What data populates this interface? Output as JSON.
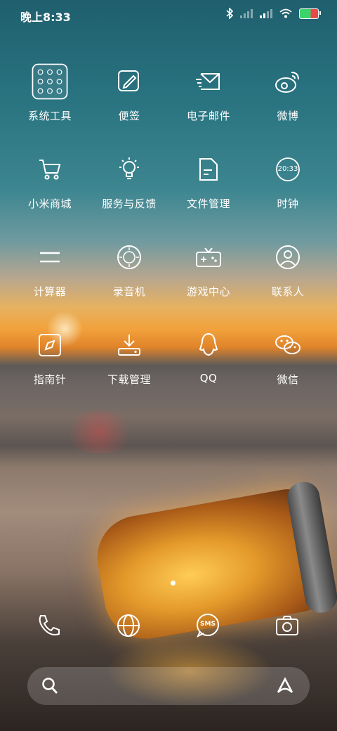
{
  "status_bar": {
    "time": "晚上8:33"
  },
  "apps": [
    {
      "name": "system-tools",
      "label": "系统工具"
    },
    {
      "name": "notes",
      "label": "便签"
    },
    {
      "name": "email",
      "label": "电子邮件"
    },
    {
      "name": "weibo",
      "label": "微博"
    },
    {
      "name": "mi-store",
      "label": "小米商城"
    },
    {
      "name": "feedback",
      "label": "服务与反馈"
    },
    {
      "name": "file-manager",
      "label": "文件管理"
    },
    {
      "name": "clock",
      "label": "时钟",
      "icon_text": "20:33"
    },
    {
      "name": "calculator",
      "label": "计算器"
    },
    {
      "name": "recorder",
      "label": "录音机"
    },
    {
      "name": "game-center",
      "label": "游戏中心"
    },
    {
      "name": "contacts",
      "label": "联系人"
    },
    {
      "name": "compass",
      "label": "指南针"
    },
    {
      "name": "downloads",
      "label": "下载管理"
    },
    {
      "name": "qq",
      "label": "QQ"
    },
    {
      "name": "wechat",
      "label": "微信"
    }
  ],
  "dock": {
    "sms_text": "SMS"
  }
}
